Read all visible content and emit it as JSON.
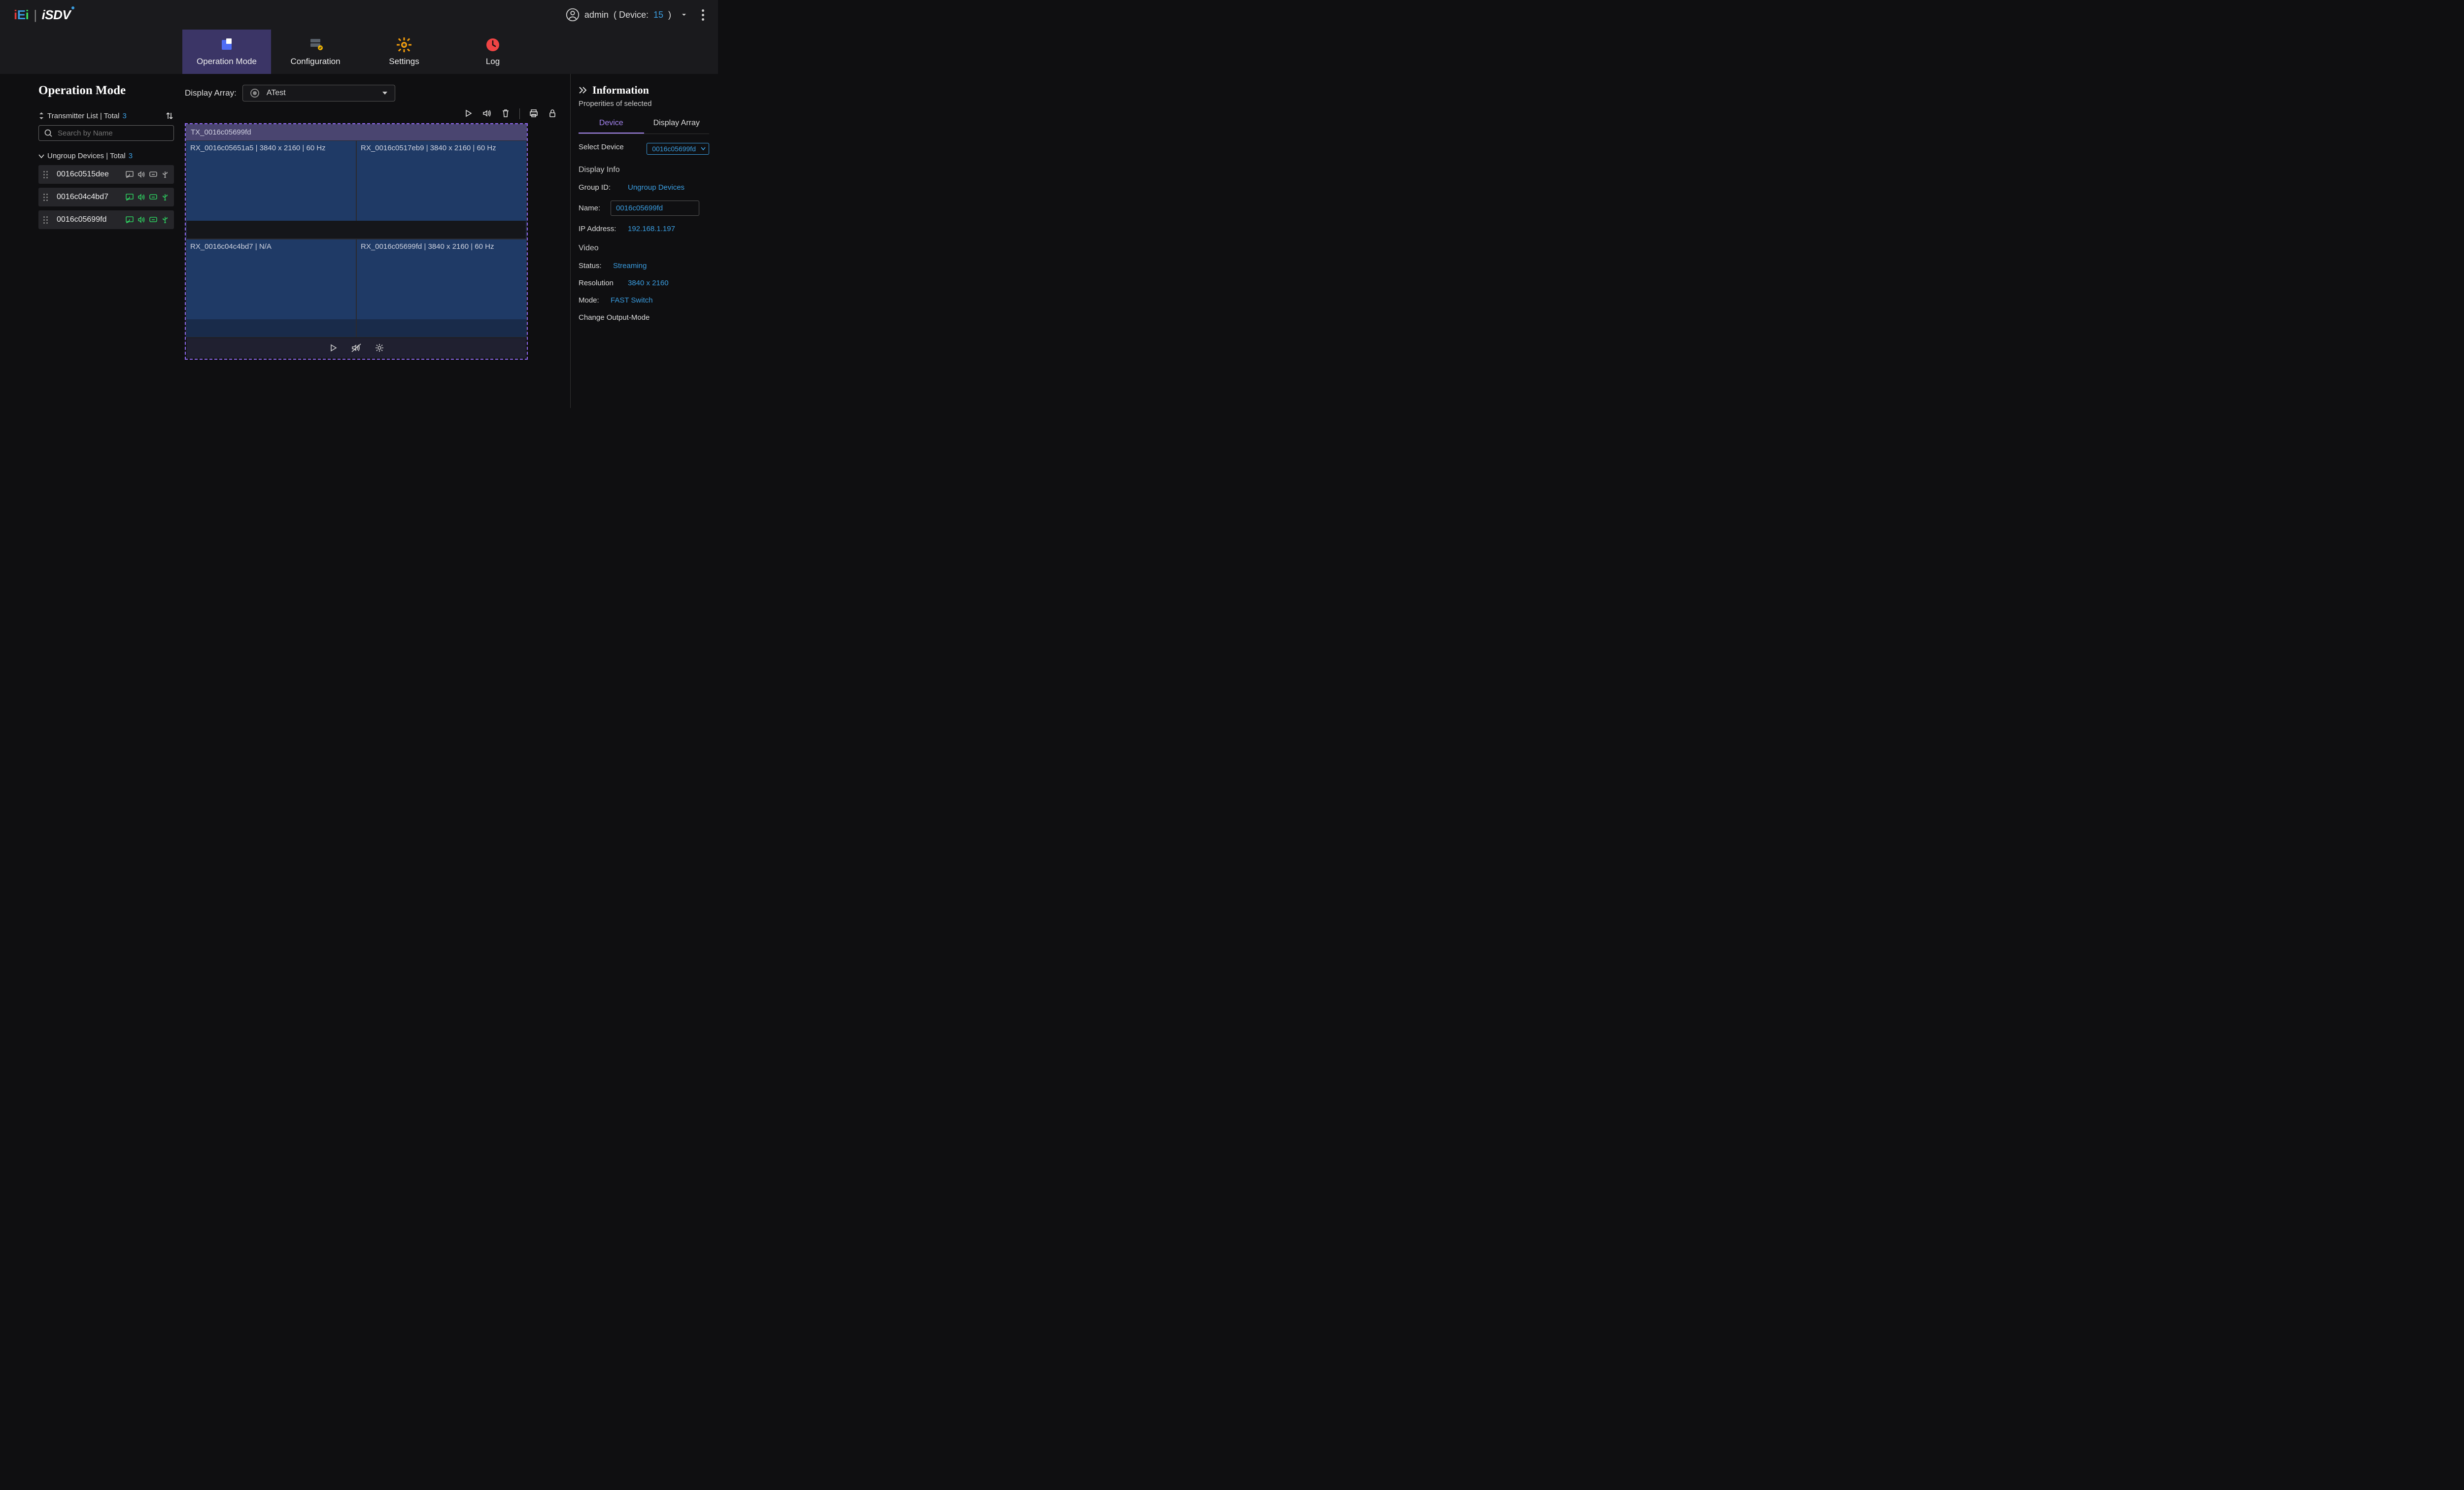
{
  "brand": {
    "iei": [
      "i",
      "E",
      "i"
    ],
    "isdv": "iSDV"
  },
  "user": {
    "name": "admin",
    "device_label_prefix": " ( Device: ",
    "device_count": "15",
    "device_label_suffix": " )"
  },
  "nav": [
    {
      "label": "Operation Mode",
      "icon": "tiles-icon",
      "active": true
    },
    {
      "label": "Configuration",
      "icon": "server-icon",
      "active": false
    },
    {
      "label": "Settings",
      "icon": "gear-icon",
      "active": false
    },
    {
      "label": "Log",
      "icon": "clock-icon",
      "active": false
    }
  ],
  "left": {
    "page_title": "Operation Mode",
    "transmitter_list_label": "Transmitter List | Total",
    "transmitter_total": "3",
    "search_placeholder": "Search by Name",
    "ungroup_label": "Ungroup Devices | Total",
    "ungroup_total": "3",
    "devices": [
      {
        "id": "0016c0515dee",
        "on": false
      },
      {
        "id": "0016c04c4bd7",
        "on": true
      },
      {
        "id": "0016c05699fd",
        "on": true
      }
    ]
  },
  "center": {
    "display_array_label": "Display Array:",
    "array_selected": "ATest",
    "tx_header": "TX_0016c05699fd",
    "rx": [
      "RX_0016c05651a5 | 3840 x 2160 | 60 Hz",
      "RX_0016c0517eb9 | 3840 x 2160 | 60 Hz",
      "RX_0016c04c4bd7 | N/A",
      "RX_0016c05699fd | 3840 x 2160 | 60 Hz"
    ]
  },
  "right": {
    "title": "Information",
    "subtitle": "Properities of selected",
    "tabs": [
      "Device",
      "Display Array"
    ],
    "active_tab": 0,
    "select_device_label": "Select Device",
    "select_device_value": "0016c05699fd",
    "display_info_head": "Display Info",
    "group_id_label": "Group ID:",
    "group_id_value": "Ungroup Devices",
    "name_label": "Name:",
    "name_value": "0016c05699fd",
    "ip_label": "IP Address:",
    "ip_value": "192.168.1.197",
    "video_head": "Video",
    "status_label": "Status:",
    "status_value": "Streaming",
    "resolution_label": "Resolution",
    "resolution_value": "3840 x 2160",
    "mode_label": "Mode:",
    "mode_value": "FAST Switch",
    "change_output_label": "Change Output-Mode"
  }
}
